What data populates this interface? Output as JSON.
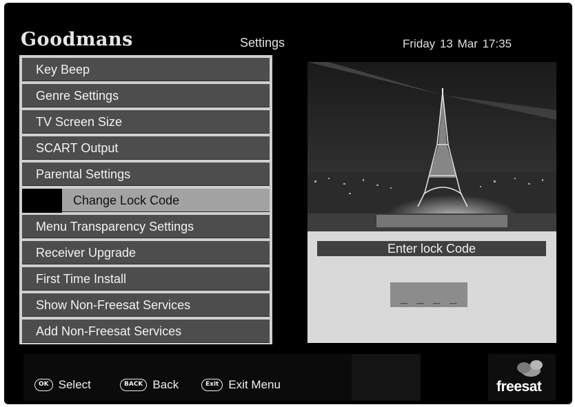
{
  "header": {
    "brand": "Goodmans",
    "title": "Settings",
    "datetime": "Friday 13 Mar 17:35"
  },
  "menu": {
    "items": [
      {
        "label": "Key Beep",
        "selected": false,
        "sub": false
      },
      {
        "label": "Genre Settings",
        "selected": false,
        "sub": false
      },
      {
        "label": "TV Screen Size",
        "selected": false,
        "sub": false
      },
      {
        "label": "SCART Output",
        "selected": false,
        "sub": false
      },
      {
        "label": "Parental Settings",
        "selected": false,
        "sub": false
      },
      {
        "label": "Change Lock Code",
        "selected": true,
        "sub": true
      },
      {
        "label": "Menu Transparency Settings",
        "selected": false,
        "sub": false
      },
      {
        "label": "Receiver Upgrade",
        "selected": false,
        "sub": false
      },
      {
        "label": "First Time Install",
        "selected": false,
        "sub": false
      },
      {
        "label": "Show Non-Freesat Services",
        "selected": false,
        "sub": false
      },
      {
        "label": "Add Non-Freesat Services",
        "selected": false,
        "sub": false
      }
    ]
  },
  "entry": {
    "title": "Enter lock Code",
    "code_mask": "_ _ _ _"
  },
  "footer": {
    "select": {
      "key": "OK",
      "label": "Select",
      "icon": "ok-button-icon"
    },
    "back": {
      "key": "BACK",
      "label": "Back",
      "icon": "back-button-icon"
    },
    "exit": {
      "key": "Exit",
      "label": "Exit Menu",
      "icon": "exit-button-icon"
    },
    "logo": "freesat"
  },
  "colors": {
    "menu_item": "#4d4d4d",
    "menu_selected": "#a3a3a3",
    "panel": "#d9d9d9",
    "background": "#000000"
  }
}
